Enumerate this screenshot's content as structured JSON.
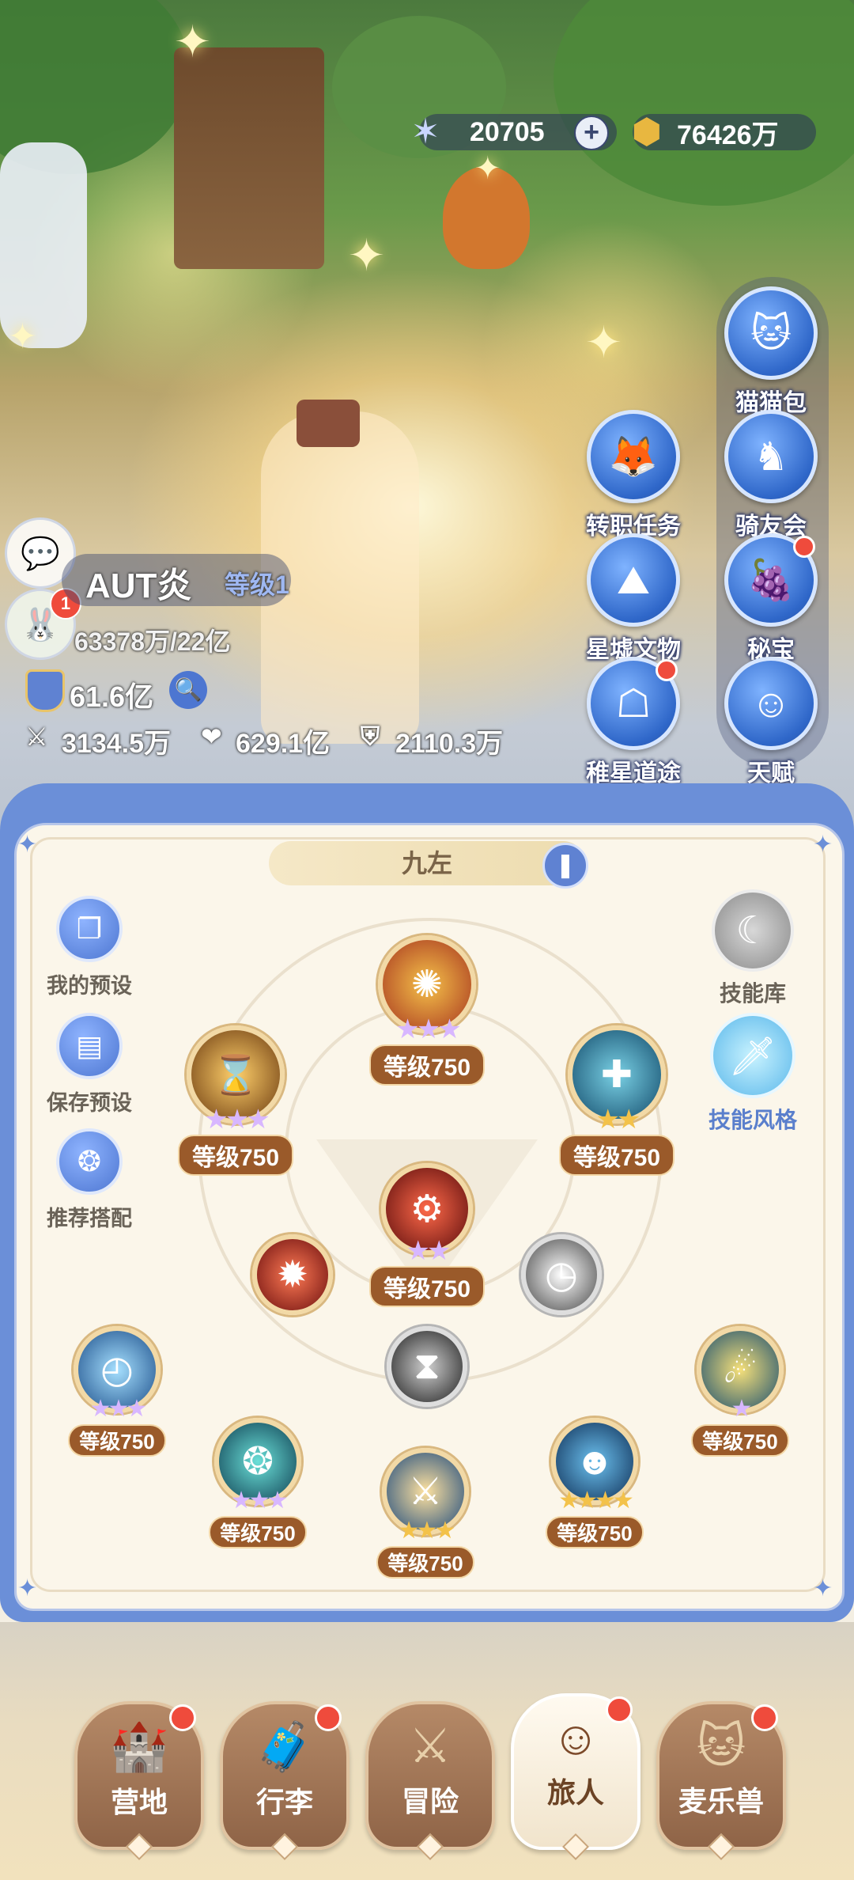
{
  "resources": {
    "stars": "20705",
    "gold": "76426万"
  },
  "side_menu": [
    {
      "label": "猫猫包",
      "icon": "cat-bag-icon"
    },
    {
      "label": "转职任务",
      "icon": "fox-mask-icon"
    },
    {
      "label": "骑友会",
      "icon": "horse-icon"
    },
    {
      "label": "星墟文物",
      "icon": "mountain-relic-icon"
    },
    {
      "label": "秘宝",
      "icon": "treasure-icon"
    },
    {
      "label": "稚星道途",
      "icon": "hooded-figure-icon"
    },
    {
      "label": "天赋",
      "icon": "head-brain-icon"
    }
  ],
  "player": {
    "name": "AUT炎",
    "level": "等级1",
    "exp": "63378万/22亿",
    "power": "61.6亿",
    "attack": "3134.5万",
    "hp": "629.1亿",
    "defense": "2110.3万",
    "chat_badge": "1"
  },
  "panel": {
    "preset_name": "九左",
    "left_buttons": [
      {
        "label": "我的预设",
        "icon": "cards-icon"
      },
      {
        "label": "保存预设",
        "icon": "save-icon"
      },
      {
        "label": "推荐搭配",
        "icon": "recommend-icon"
      }
    ],
    "right_buttons": [
      {
        "label": "技能库",
        "icon": "moon-icon"
      },
      {
        "label": "技能风格",
        "icon": "sword-style-icon"
      }
    ],
    "skills": [
      {
        "level": "等级750",
        "stars": 3
      },
      {
        "level": "等级750",
        "stars": 3
      },
      {
        "level": "等级750",
        "stars": 2
      },
      {
        "level": "等级750",
        "stars": 2
      },
      {
        "level": "等级750",
        "stars": 3
      },
      {
        "level": "等级750",
        "stars": 1
      },
      {
        "level": "等级750",
        "stars": 3
      },
      {
        "level": "等级750",
        "stars": 4
      },
      {
        "level": "等级750",
        "stars": 3
      }
    ]
  },
  "bottom_nav": [
    {
      "label": "营地",
      "icon": "castle-icon"
    },
    {
      "label": "行李",
      "icon": "luggage-icon"
    },
    {
      "label": "冒险",
      "icon": "crossed-swords-icon"
    },
    {
      "label": "旅人",
      "icon": "traveler-icon"
    },
    {
      "label": "麦乐兽",
      "icon": "beast-icon"
    }
  ],
  "colors": {
    "accent_blue": "#6b8fd8",
    "level_badge": "#9a5a2a",
    "star_purple": "#c9a2f0",
    "star_gold": "#f3c24a",
    "red_dot": "#ef4b3c"
  }
}
